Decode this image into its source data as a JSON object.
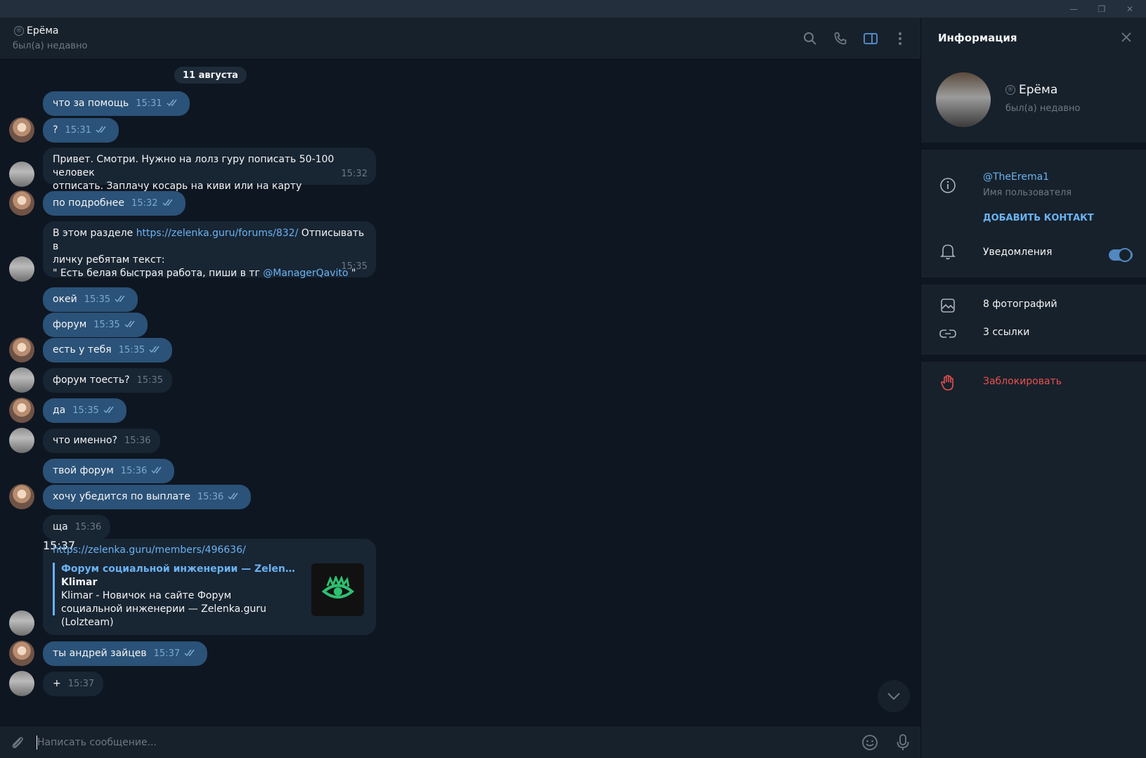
{
  "window": {
    "minimize": "—",
    "restore": "❐",
    "close": "✕"
  },
  "header": {
    "name": "Ерёма",
    "status": "был(а) недавно",
    "reg_mark": "®"
  },
  "date_label": "11 августа",
  "messages": [
    {
      "text": "что за помощь",
      "time": "15:31",
      "dir": "out"
    },
    {
      "text": "?",
      "time": "15:31",
      "dir": "out"
    },
    {
      "line1": "Привет. Смотри. Нужно на лолз гуру пописать 50-100 человек",
      "line2": "отписать. Заплачу косарь на киви или на карту",
      "time": "15:32",
      "dir": "in"
    },
    {
      "text": "по подробнее",
      "time": "15:32",
      "dir": "out"
    },
    {
      "pre": "В этом разделе ",
      "link": "https://zelenka.guru/forums/832/",
      "post": "  Отписывать в",
      "line2": "личку ребятам текст:",
      "line3_pre": " \" Есть белая быстрая работа, пиши в тг ",
      "mention": "@ManagerQavito",
      "line3_post": " \"",
      "time": "15:35",
      "dir": "in"
    },
    {
      "text": "окей",
      "time": "15:35",
      "dir": "out"
    },
    {
      "text": "форум",
      "time": "15:35",
      "dir": "out"
    },
    {
      "text": "есть у тебя",
      "time": "15:35",
      "dir": "out"
    },
    {
      "text": "форум тоесть?",
      "time": "15:35",
      "dir": "in"
    },
    {
      "text": "да",
      "time": "15:35",
      "dir": "out"
    },
    {
      "text": "что именно?",
      "time": "15:36",
      "dir": "in"
    },
    {
      "text": "твой форум",
      "time": "15:36",
      "dir": "out"
    },
    {
      "text": "хочу убедится по выплате",
      "time": "15:36",
      "dir": "out"
    },
    {
      "text": "ща",
      "time": "15:36",
      "dir": "in"
    },
    {
      "text": "ты андрей зайцев",
      "time": "15:37",
      "dir": "out"
    },
    {
      "text": "+",
      "time": "15:37",
      "dir": "in"
    }
  ],
  "preview": {
    "url": "https://zelenka.guru/members/496636/",
    "site": "Форум социальной инженерии —  Zelenka.gur...",
    "title": "Klimar",
    "desc": "Klimar - Новичок на сайте Форум социальной инженерии —  Zelenka.guru (Lolzteam)",
    "time": "15:37"
  },
  "composer": {
    "placeholder": "Написать сообщение..."
  },
  "panel": {
    "title": "Информация",
    "name": "Ерёма",
    "status": "был(а) недавно",
    "username": "@TheErema1",
    "username_label": "Имя пользователя",
    "add_contact": "ДОБАВИТЬ КОНТАКТ",
    "notifications": "Уведомления",
    "notifications_on": true,
    "photos": "8 фотографий",
    "links": "3 ссылки",
    "block": "Заблокировать"
  },
  "colors": {
    "accent": "#6ab3f3",
    "out_bubble": "#2b5278",
    "in_bubble": "#182533",
    "danger": "#e8504f"
  }
}
